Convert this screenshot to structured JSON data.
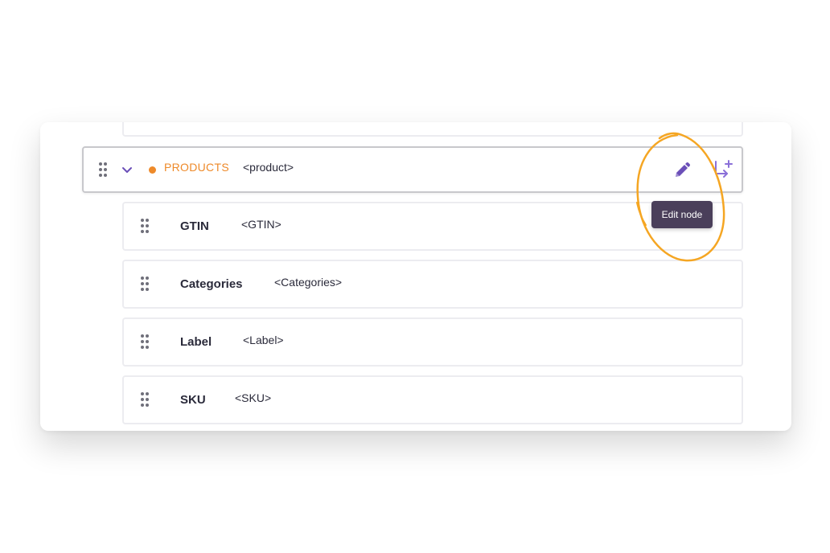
{
  "parent": {
    "label": "PRODUCTS",
    "tag": "<product>"
  },
  "children": [
    {
      "label": "GTIN",
      "tag": "<GTIN>"
    },
    {
      "label": "Categories",
      "tag": "<Categories>"
    },
    {
      "label": "Label",
      "tag": "<Label>"
    },
    {
      "label": "SKU",
      "tag": "<SKU>"
    }
  ],
  "tooltip": {
    "text": "Edit node"
  },
  "icons": {
    "drag": "drag-handle-icon",
    "expand": "chevron-down-icon",
    "edit": "pencil-icon",
    "add_child": "add-child-node-icon"
  },
  "colors": {
    "accent_orange": "#ee8a2a",
    "icon_purple": "#6b4fb8",
    "tooltip_bg": "#4a3f5a",
    "highlight_circle": "#f5a623"
  }
}
